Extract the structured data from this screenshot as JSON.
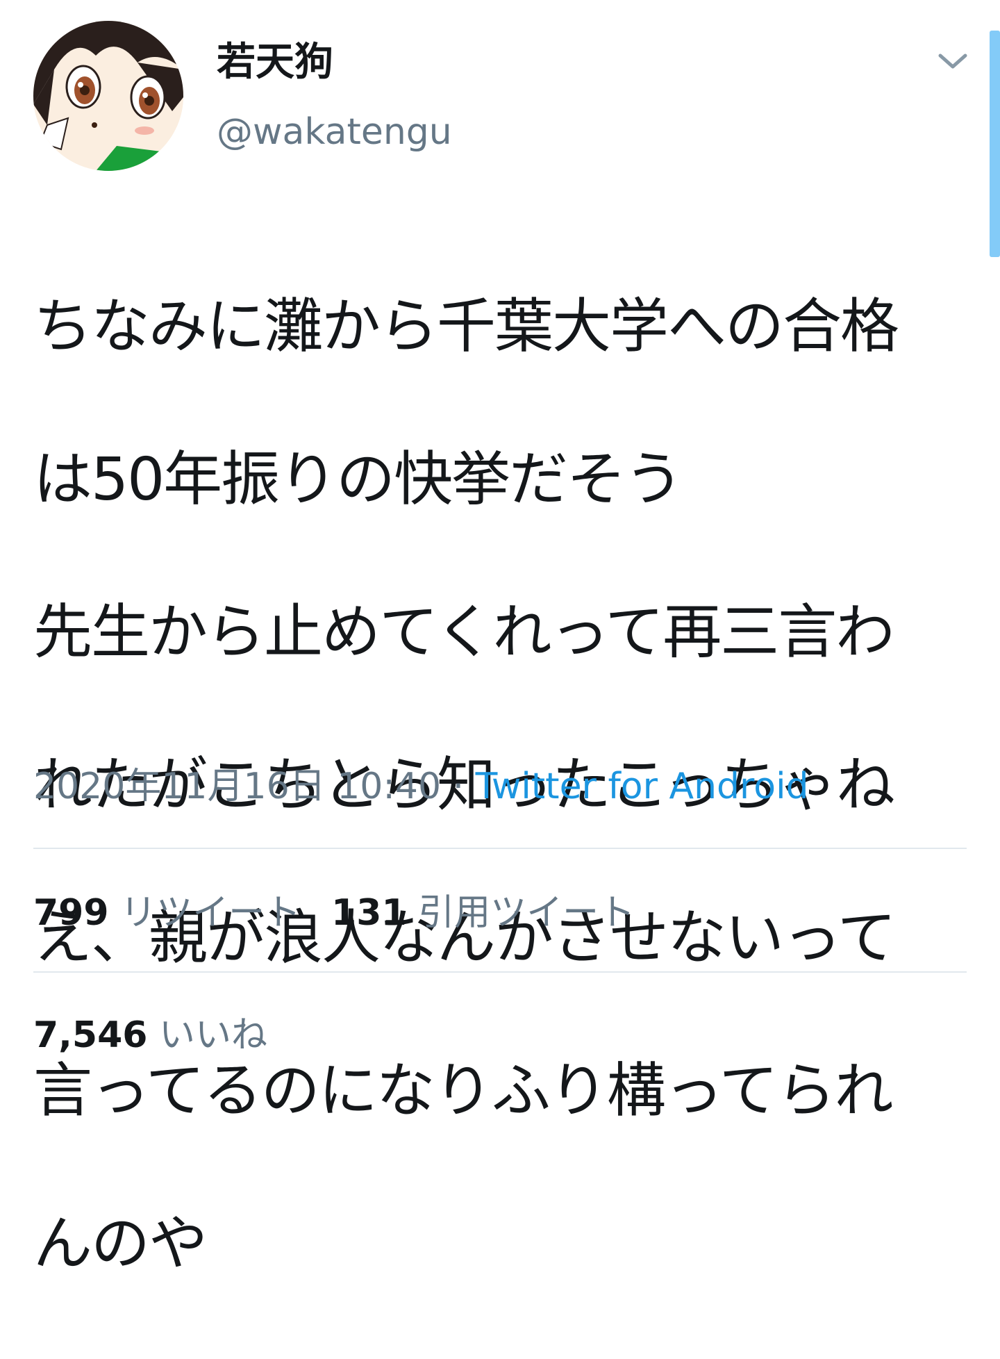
{
  "user": {
    "display_name": "若天狗",
    "handle": "@wakatengu",
    "avatar_icon": "anime-character-avatar",
    "more_icon": "chevron-down-icon"
  },
  "tweet": {
    "text_lines": [
      "ちなみに灘から千葉大学への合格",
      "は50年振りの快挙だそう",
      "先生から止めてくれって再三言わ",
      "れたがこちとら知ったこっちゃね",
      "え、親が浪人なんかさせないって",
      "言ってるのになりふり構ってられ",
      "んのや"
    ],
    "timestamp": "2020年11月16日 10:40",
    "separator": " · ",
    "source": "Twitter for Android"
  },
  "stats": {
    "retweets_count": "799",
    "retweets_label": "リツイート",
    "quotes_count": "131",
    "quotes_label": "引用ツイート",
    "likes_count": "7,546",
    "likes_label": "いいね"
  },
  "colors": {
    "text": "#14171a",
    "secondary": "#657786",
    "link": "#1b95e0",
    "divider": "#e1e8ed",
    "scrollbar": "#1da1f2"
  }
}
